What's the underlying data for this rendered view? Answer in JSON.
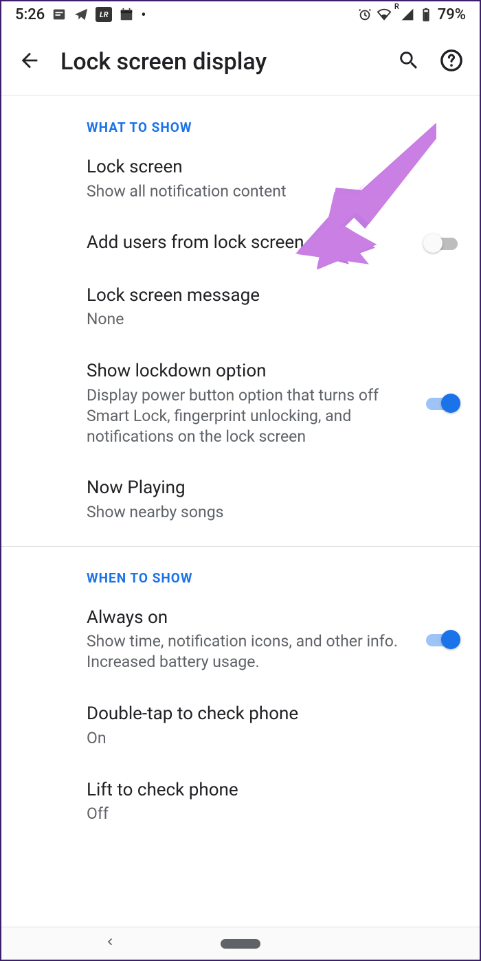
{
  "status": {
    "time": "5:26",
    "battery": "79%"
  },
  "appbar": {
    "title": "Lock screen display"
  },
  "sections": {
    "what": "WHAT TO SHOW",
    "when": "WHEN TO SHOW"
  },
  "prefs": {
    "lockscreen": {
      "title": "Lock screen",
      "summary": "Show all notification content"
    },
    "addusers": {
      "title": "Add users from lock screen"
    },
    "message": {
      "title": "Lock screen message",
      "summary": "None"
    },
    "lockdown": {
      "title": "Show lockdown option",
      "summary": "Display power button option that turns off Smart Lock, fingerprint unlocking, and notifications on the lock screen"
    },
    "nowplaying": {
      "title": "Now Playing",
      "summary": "Show nearby songs"
    },
    "alwayson": {
      "title": "Always on",
      "summary": "Show time, notification icons, and other info. Increased battery usage."
    },
    "doubletap": {
      "title": "Double-tap to check phone",
      "summary": "On"
    },
    "lift": {
      "title": "Lift to check phone",
      "summary": "Off"
    }
  }
}
